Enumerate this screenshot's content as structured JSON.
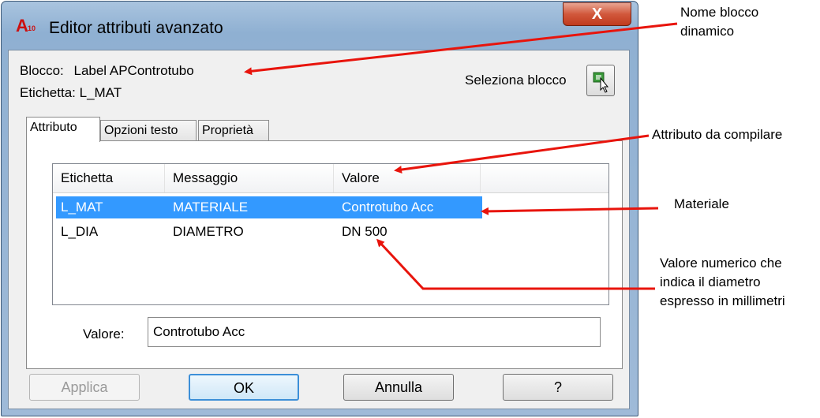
{
  "window": {
    "title": "Editor attributi avanzato",
    "icon_text": "A",
    "icon_badge": "10",
    "close_label": "X"
  },
  "info": {
    "blocco_label": "Blocco:",
    "blocco_value": "Label APControtubo",
    "etichetta_label": "Etichetta:",
    "etichetta_value": "L_MAT",
    "select_block_label": "Seleziona blocco"
  },
  "tabs": [
    {
      "label": "Attributo",
      "active": true
    },
    {
      "label": "Opzioni testo",
      "active": false
    },
    {
      "label": "Proprietà",
      "active": false
    }
  ],
  "list": {
    "columns": [
      "Etichetta",
      "Messaggio",
      "Valore"
    ],
    "rows": [
      {
        "etichetta": "L_MAT",
        "messaggio": "MATERIALE",
        "valore": "Controtubo Acc",
        "selected": true
      },
      {
        "etichetta": "L_DIA",
        "messaggio": "DIAMETRO",
        "valore": "DN 500",
        "selected": false
      }
    ]
  },
  "value_field": {
    "label": "Valore:",
    "value": "Controtubo Acc"
  },
  "buttons": {
    "apply": "Applica",
    "ok": "OK",
    "cancel": "Annulla",
    "help": "?"
  },
  "annotations": {
    "block_name": [
      "Nome blocco",
      "dinamico"
    ],
    "attribute": [
      "Attributo da compilare"
    ],
    "material": [
      "Materiale"
    ],
    "numeric": [
      "Valore numerico che",
      "indica il diametro",
      "espresso in millimetri"
    ]
  },
  "colors": {
    "selection": "#3399ff",
    "arrow": "#e8140c"
  }
}
